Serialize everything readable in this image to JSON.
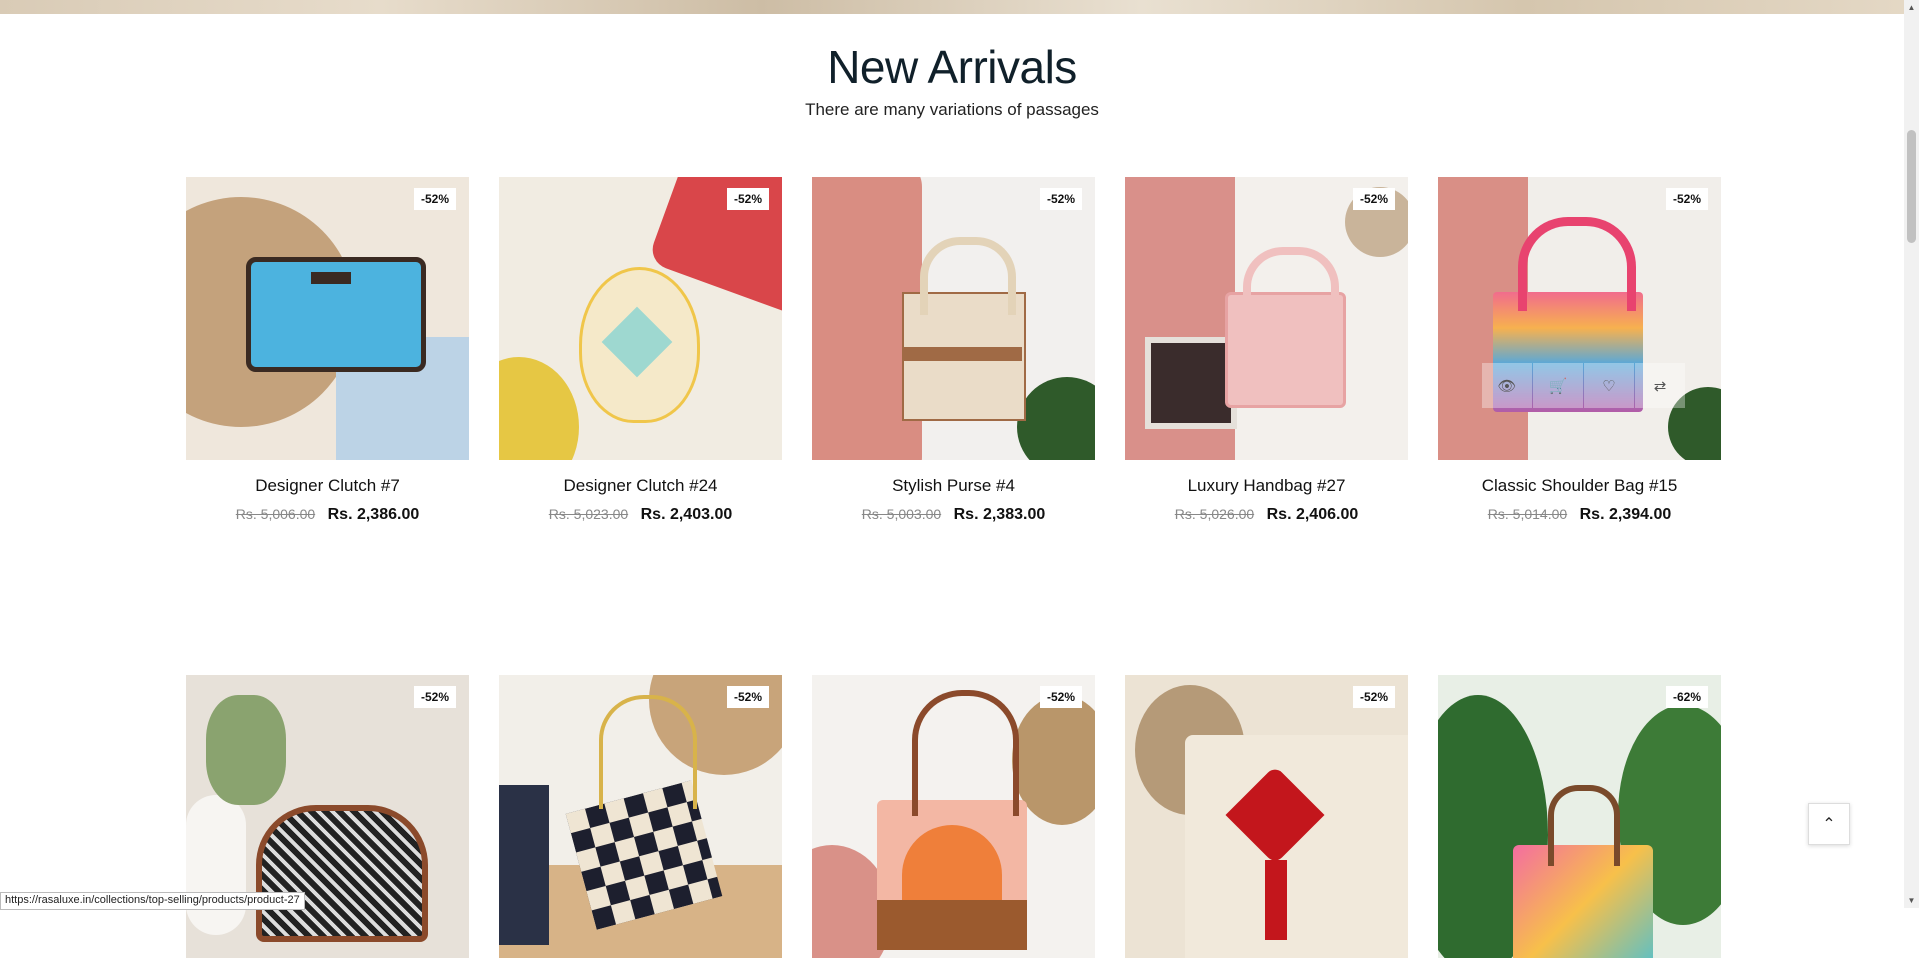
{
  "section": {
    "title": "New Arrivals",
    "subtitle": "There are many variations of passages"
  },
  "products": [
    {
      "name": "Designer Clutch #7",
      "old_price": "Rs. 5,006.00",
      "price": "Rs. 2,386.00",
      "badge": "-52%"
    },
    {
      "name": "Designer Clutch #24",
      "old_price": "Rs. 5,023.00",
      "price": "Rs. 2,403.00",
      "badge": "-52%"
    },
    {
      "name": "Stylish Purse #4",
      "old_price": "Rs. 5,003.00",
      "price": "Rs. 2,383.00",
      "badge": "-52%"
    },
    {
      "name": "Luxury Handbag #27",
      "old_price": "Rs. 5,026.00",
      "price": "Rs. 2,406.00",
      "badge": "-52%"
    },
    {
      "name": "Classic Shoulder Bag #15",
      "old_price": "Rs. 5,014.00",
      "price": "Rs. 2,394.00",
      "badge": "-52%"
    },
    {
      "name": "",
      "old_price": "",
      "price": "",
      "badge": "-52%"
    },
    {
      "name": "",
      "old_price": "",
      "price": "",
      "badge": "-52%"
    },
    {
      "name": "",
      "old_price": "",
      "price": "",
      "badge": "-52%"
    },
    {
      "name": "",
      "old_price": "",
      "price": "",
      "badge": "-52%"
    },
    {
      "name": "",
      "old_price": "",
      "price": "",
      "badge": "-62%"
    }
  ],
  "hover_actions": [
    "eye-icon",
    "cart-icon",
    "heart-icon",
    "compare-icon"
  ],
  "scroll_top_icon": "chevron-up-icon",
  "status_bar": {
    "url": "https://rasaluxe.in/collections/top-selling/products/product-27"
  }
}
